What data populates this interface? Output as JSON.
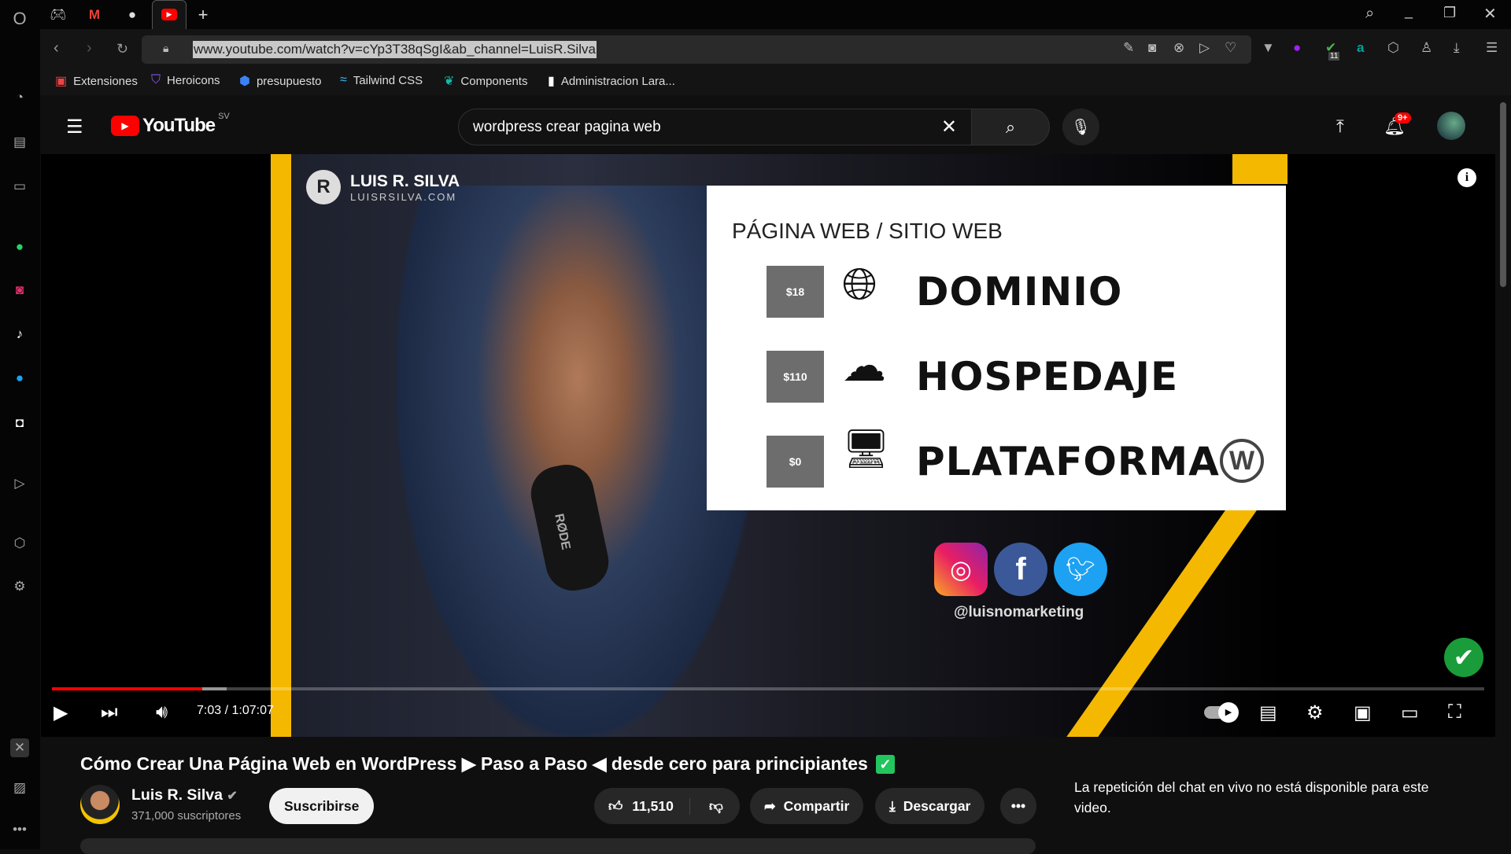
{
  "browser": {
    "url": "www.youtube.com/watch?v=cYp3T38qSgI&ab_channel=LuisR.Silva",
    "tabs": [
      "gamepad-icon",
      "gmail-icon",
      "github-icon",
      "youtube-icon"
    ],
    "bookmarks": [
      {
        "label": "Extensiones",
        "icon": "chrome-store-icon"
      },
      {
        "label": "Heroicons",
        "icon": "shield-icon"
      },
      {
        "label": "presupuesto",
        "icon": "rocket-icon"
      },
      {
        "label": "Tailwind CSS",
        "icon": "tailwind-icon"
      },
      {
        "label": "Components",
        "icon": "leaf-icon"
      },
      {
        "label": "Administracion Lara...",
        "icon": "document-icon"
      }
    ],
    "extension_badge": "11"
  },
  "youtube": {
    "logo": "YouTube",
    "country": "SV",
    "search_value": "wordpress crear pagina web",
    "notifications": "9+",
    "accent": "#ff0000"
  },
  "video": {
    "overlay_brand": "LUIS R. SILVA",
    "overlay_site": "LUISRSILVA.COM",
    "slide_title": "PÁGINA WEB / SITIO WEB",
    "slide_rows": [
      {
        "price": "$18",
        "label": "DOMINIO"
      },
      {
        "price": "$110",
        "label": "HOSPEDAJE"
      },
      {
        "price": "$0",
        "label": "PLATAFORMA"
      }
    ],
    "social_handle": "@luisnomarketing",
    "mic_brand": "RØDE",
    "time": "7:03 / 1:07:07",
    "progress_percent": 10.5,
    "buffered_percent": 12.2
  },
  "info": {
    "title": "Cómo Crear Una Página Web en WordPress ▶ Paso a Paso ◀ desde cero para principiantes",
    "channel": "Luis R. Silva",
    "subscribers": "371,000 suscriptores",
    "subscribe": "Suscribirse",
    "likes": "11,510",
    "share": "Compartir",
    "download": "Descargar",
    "chat_notice": "La repetición del chat en vivo no está disponible para este video."
  }
}
